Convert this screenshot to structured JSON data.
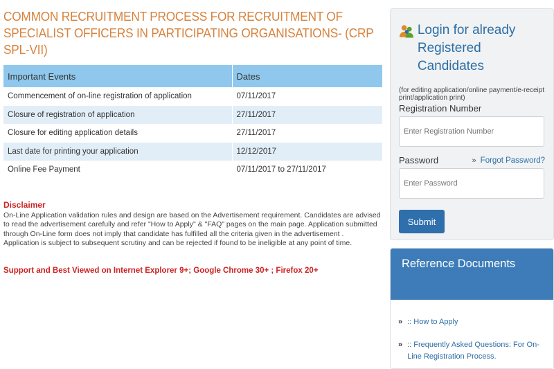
{
  "page": {
    "title": "COMMON RECRUITMENT PROCESS FOR RECRUITMENT OF SPECIALIST OFFICERS IN PARTICIPATING ORGANISATIONS- (CRP SPL-VII)"
  },
  "events_table": {
    "headers": [
      "Important Events",
      "Dates"
    ],
    "rows": [
      {
        "event": "Commencement of on-line registration of application",
        "date": "07/11/2017"
      },
      {
        "event": "Closure of registration of application",
        "date": "27/11/2017"
      },
      {
        "event": "Closure for editing application details",
        "date": "27/11/2017"
      },
      {
        "event": "Last date for printing your application",
        "date": "12/12/2017"
      },
      {
        "event": "Online Fee Payment",
        "date": "07/11/2017 to 27/11/2017"
      }
    ]
  },
  "disclaimer": {
    "title": "Disclaimer",
    "text": "On-Line Application validation rules and design are based on the Advertisement requirement. Candidates are advised to read the advertisement carefully and refer \"How to Apply\" & \"FAQ\" pages on the main page. Application submitted through On-Line form does not imply that candidate has fulfilled all the criteria given in the advertisement . Application is subject to subsequent scrutiny and can be rejected if found to be ineligible at any point of time."
  },
  "support_text": "Support and Best Viewed on Internet Explorer 9+; Google Chrome 30+ ; Firefox 20+",
  "login": {
    "title_line1": "Login for already",
    "title_line2": "Registered Candidates",
    "note": "(for editing application/online payment/e-receipt print/application print)",
    "registration_label": "Registration Number",
    "registration_placeholder": "Enter Registration Number",
    "password_label": "Password",
    "forgot_chevron": "»",
    "forgot_label": "Forgot Password?",
    "password_placeholder": "Enter Password",
    "submit_label": "Submit",
    "icon": "users-icon"
  },
  "reference": {
    "title": "Reference Documents",
    "items": [
      {
        "arrow": "»",
        "label": ":: How to Apply"
      },
      {
        "arrow": "»",
        "label": ":: Frequently Asked Questions: For On-Line Registration Process."
      }
    ]
  },
  "colors": {
    "title": "#d7823c",
    "table_header": "#8fc8ec",
    "table_stripe": "#e2eef7",
    "alert": "#cc2222",
    "accent": "#2d6ea6",
    "button": "#2f6fac",
    "reference_header": "#3d7cb8"
  }
}
